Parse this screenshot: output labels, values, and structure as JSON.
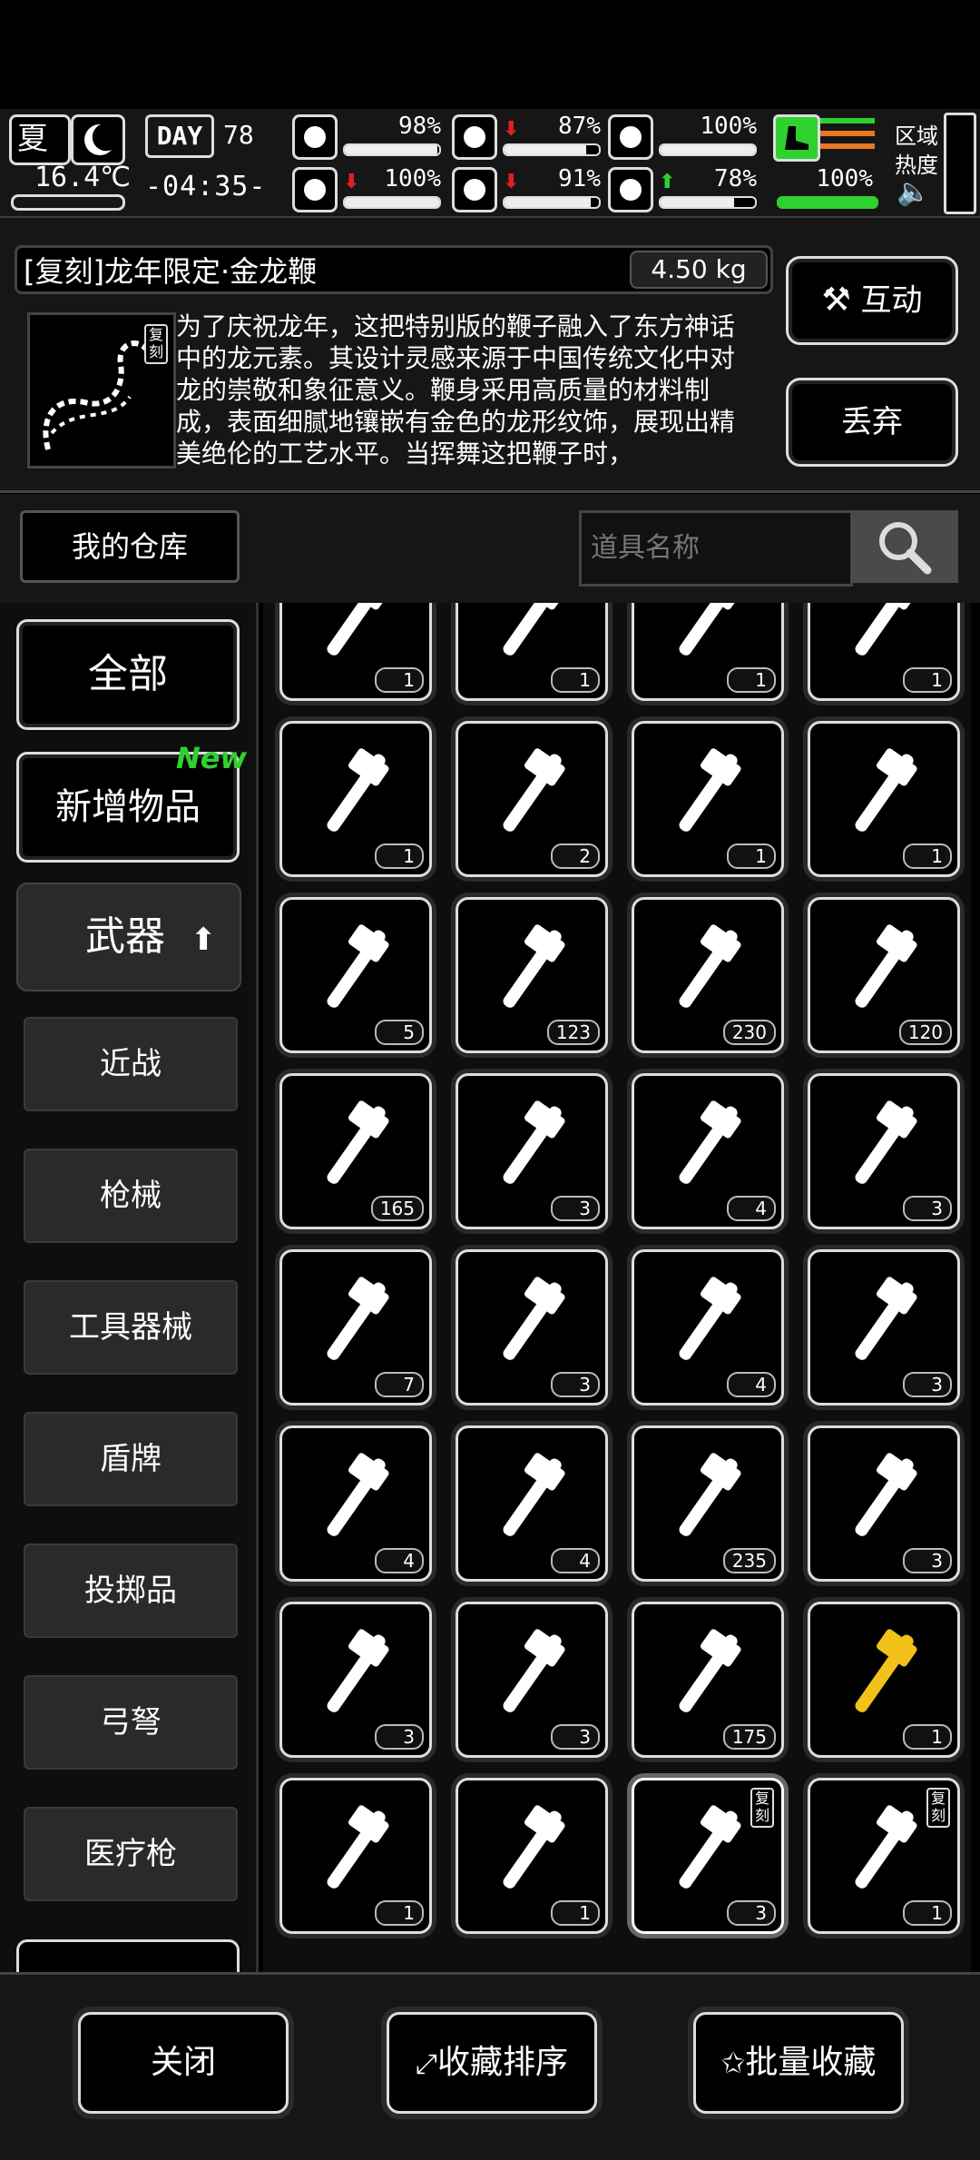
{
  "status": {
    "season": "夏",
    "temperature": "16.4℃",
    "day_label": "DAY",
    "day": "78",
    "time": "-04:35-",
    "stats": [
      {
        "icon": "medkit-icon",
        "value": "98%",
        "fill": 0.98,
        "arrow": ""
      },
      {
        "icon": "stomach-icon",
        "value": "87%",
        "fill": 0.87,
        "arrow": "down"
      },
      {
        "icon": "bladder-icon",
        "value": "100%",
        "fill": 1.0,
        "arrow": ""
      },
      {
        "icon": "brain-icon",
        "value": "100%",
        "fill": 1.0,
        "arrow": "down"
      },
      {
        "icon": "water-drop-icon",
        "value": "91%",
        "fill": 0.91,
        "arrow": "down"
      },
      {
        "icon": "heart-icon",
        "value": "78%",
        "fill": 0.78,
        "arrow": "up"
      }
    ],
    "stamina": {
      "value": "100%",
      "fill": 1.0
    },
    "region_label_1": "区域",
    "region_label_2": "热度"
  },
  "item": {
    "name": "[复刻]龙年限定·金龙鞭",
    "weight": "4.50 kg",
    "badge": "复刻",
    "description": "为了庆祝龙年，这把特别版的鞭子融入了东方神话中的龙元素。其设计灵感来源于中国传统文化中对龙的崇敬和象征意义。鞭身采用高质量的材料制成，表面细腻地镶嵌有金色的龙形纹饰，展现出精美绝伦的工艺水平。当挥舞这把鞭子时，",
    "interact_label": "互动",
    "discard_label": "丢弃"
  },
  "warehouse_label": "我的仓库",
  "search": {
    "placeholder": "道具名称"
  },
  "categories": {
    "all": "全部",
    "new": "新增物品",
    "new_tag": "New",
    "weapons": "武器",
    "sub": [
      "近战",
      "枪械",
      "工具器械",
      "盾牌",
      "投掷品",
      "弓弩",
      "医疗枪"
    ]
  },
  "grid": [
    {
      "icon": "spear-icon",
      "count": "1"
    },
    {
      "icon": "pistol-icon",
      "count": "1"
    },
    {
      "icon": "shovel-blade-icon",
      "count": "1"
    },
    {
      "icon": "blowtorch-icon",
      "count": "1"
    },
    {
      "icon": "combat-knife-icon",
      "count": "1"
    },
    {
      "icon": "axe-icon",
      "count": "2"
    },
    {
      "icon": "shovel-icon",
      "count": "1"
    },
    {
      "icon": "hatchet-icon",
      "count": "1"
    },
    {
      "icon": "shovel-icon",
      "count": "5"
    },
    {
      "icon": "stun-grenade-icon",
      "count": "123"
    },
    {
      "icon": "frag-grenade-icon",
      "count": "230"
    },
    {
      "icon": "incendiary-icon",
      "count": "120"
    },
    {
      "icon": "net-icon",
      "count": "165"
    },
    {
      "icon": "tomahawk-icon",
      "count": "3"
    },
    {
      "icon": "minigun-icon",
      "count": "4"
    },
    {
      "icon": "flamethrower-icon",
      "count": "3"
    },
    {
      "icon": "rifle-icon",
      "count": "7"
    },
    {
      "icon": "shotgun-icon",
      "count": "3"
    },
    {
      "icon": "baton-icon",
      "count": "4"
    },
    {
      "icon": "sword-icon",
      "count": "3"
    },
    {
      "icon": "chainsaw-icon",
      "count": "4"
    },
    {
      "icon": "compound-bow-icon",
      "count": "4"
    },
    {
      "icon": "smoke-grenade-icon",
      "count": "235"
    },
    {
      "icon": "sniper-rifle-icon",
      "count": "3"
    },
    {
      "icon": "armor-plate-icon",
      "count": "3"
    },
    {
      "icon": "riot-shield-icon",
      "count": "3"
    },
    {
      "icon": "net-bomb-icon",
      "count": "175"
    },
    {
      "icon": "golden-hammer-icon",
      "count": "1"
    },
    {
      "icon": "fire-axe-icon",
      "count": "1"
    },
    {
      "icon": "cleaver-icon",
      "count": "1"
    },
    {
      "icon": "dragon-whip-icon",
      "count": "3",
      "badge": "复刻",
      "selected": true
    },
    {
      "icon": "dragon-rifle-icon",
      "count": "1",
      "badge": "复刻"
    }
  ],
  "bottom": {
    "close": "关闭",
    "sort": "收藏排序",
    "batch": "批量收藏"
  },
  "colors": {
    "accent_green": "#2fd12f",
    "stamina_orange": "#e87722",
    "gold": "#f2c21a"
  }
}
